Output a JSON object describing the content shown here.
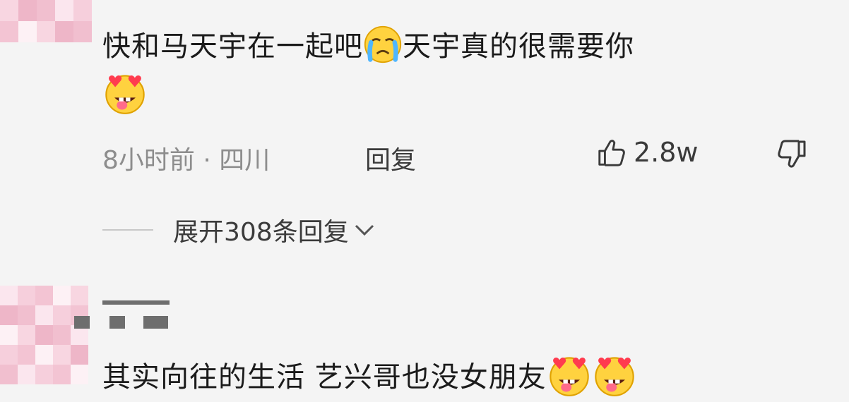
{
  "comment1": {
    "text_part1": "快和马天宇在一起吧",
    "text_part2": "天宇真的很需要你",
    "time_location": "8小时前 · 四川",
    "reply_label": "回复",
    "like_count": "2.8w",
    "expand_label": "展开308条回复"
  },
  "comment2": {
    "text": "其实向往的生活 艺兴哥也没女朋友"
  },
  "icons": {
    "crying": "crying-face-emoji",
    "heart_eyes": "heart-eyes-tongue-emoji",
    "like": "thumbs-up-icon",
    "dislike": "thumbs-down-icon",
    "expand": "chevron-down-icon"
  },
  "colors": {
    "background": "#f4f4f4",
    "text": "#1b1b1b",
    "meta": "#8d8d8d",
    "avatar_pink": "#f3c4d3"
  }
}
